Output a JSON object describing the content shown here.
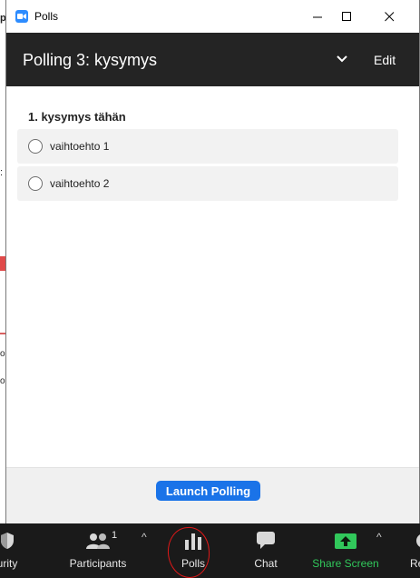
{
  "background": {
    "fragments": [
      "p",
      ":",
      "o",
      "o"
    ]
  },
  "window": {
    "title": "Polls",
    "header_title": "Polling 3: kysymys",
    "edit_label": "Edit",
    "question": "1. kysymys tähän",
    "options": [
      "vaihtoehto 1",
      "vaihtoehto 2"
    ],
    "launch_label": "Launch Polling"
  },
  "toolbar": {
    "security_label": "urity",
    "participants_label": "Participants",
    "participants_count": "1",
    "polls_label": "Polls",
    "chat_label": "Chat",
    "share_label": "Share Screen",
    "record_label": "Re"
  },
  "colors": {
    "accent": "#1a73e8",
    "header_bg": "#242424",
    "toolbar_bg": "#1a1a1a",
    "share_green": "#31c85b",
    "annotation_red": "#e01818"
  }
}
